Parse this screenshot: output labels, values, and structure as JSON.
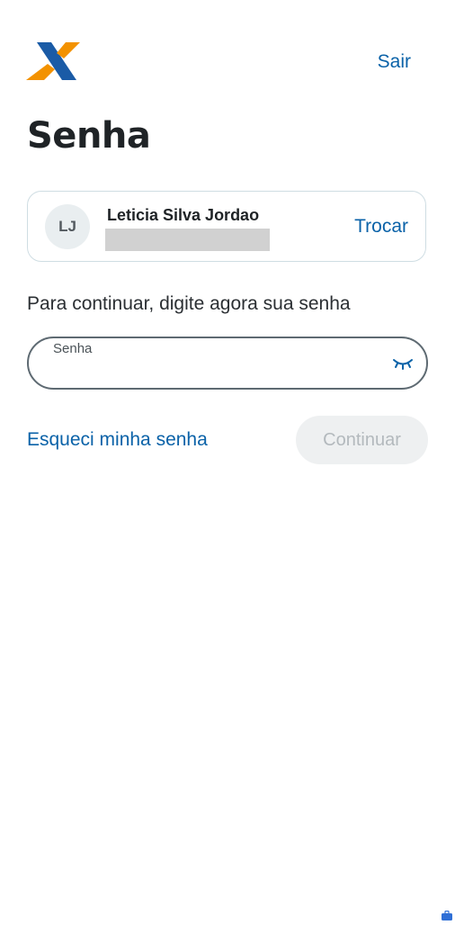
{
  "header": {
    "logo_icon": "caixa-x-logo",
    "logout_label": "Sair"
  },
  "page": {
    "title": "Senha"
  },
  "user_card": {
    "initials": "LJ",
    "name": "Leticia Silva Jordao",
    "change_label": "Trocar"
  },
  "form": {
    "instruction": "Para continuar, digite agora sua senha",
    "password_label": "Senha",
    "password_value": "",
    "toggle_icon": "eye-closed-icon",
    "forgot_label": "Esqueci minha senha",
    "continue_label": "Continuar"
  },
  "colors": {
    "brand_blue": "#0a62a8",
    "brand_orange": "#f39200",
    "disabled_button_bg": "#eef0f1",
    "disabled_button_text": "#b3b9bd"
  }
}
